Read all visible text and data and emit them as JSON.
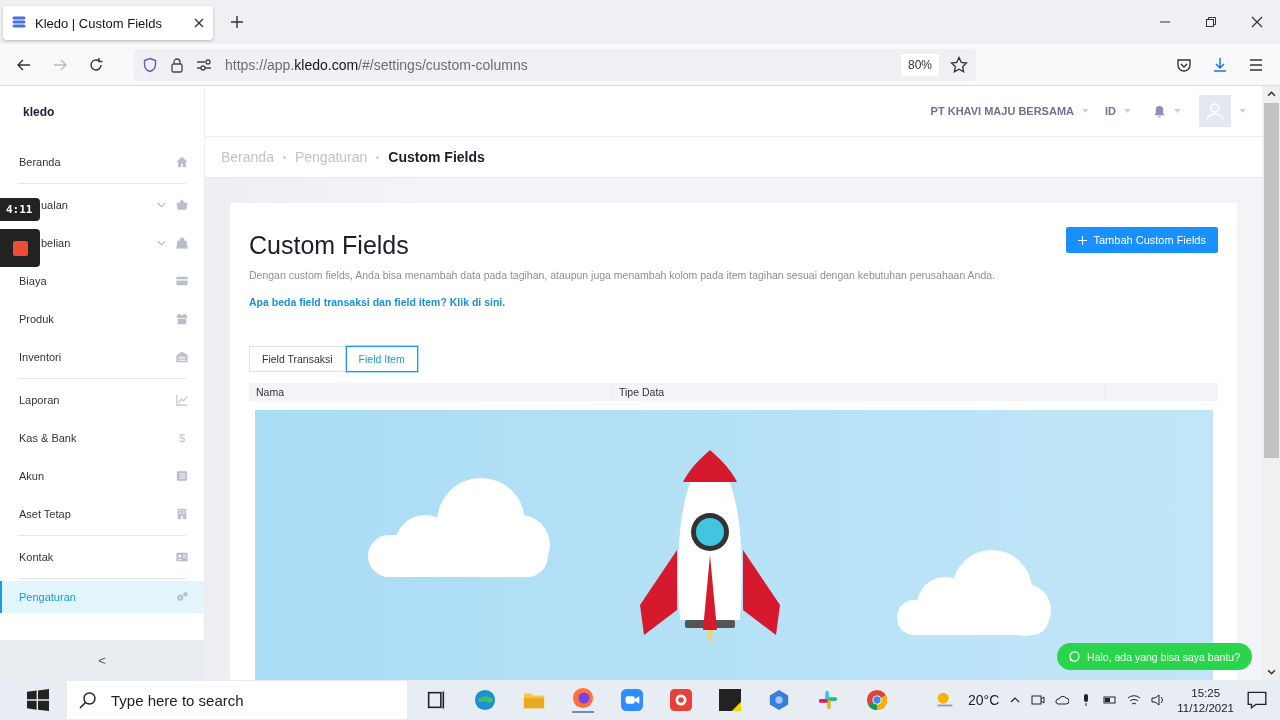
{
  "browser": {
    "tab_title": "Kledo | Custom Fields",
    "url_scheme": "https://app.",
    "url_domain": "kledo.com",
    "url_path": "/#/settings/custom-columns",
    "zoom": "80%"
  },
  "header": {
    "company": "PT KHAVI MAJU BERSAMA",
    "language": "ID"
  },
  "sidebar": {
    "logo": "kledo",
    "items": [
      {
        "label": "Beranda",
        "selected": false,
        "has_submenu": false,
        "divider_after": true
      },
      {
        "label": "ualan",
        "selected": false,
        "has_submenu": true,
        "divider_after": false
      },
      {
        "label": "belian",
        "selected": false,
        "has_submenu": true,
        "divider_after": false
      },
      {
        "label": "Biaya",
        "selected": false,
        "has_submenu": false,
        "divider_after": false
      },
      {
        "label": "Produk",
        "selected": false,
        "has_submenu": false,
        "divider_after": false
      },
      {
        "label": "Inventori",
        "selected": false,
        "has_submenu": false,
        "divider_after": true
      },
      {
        "label": "Laporan",
        "selected": false,
        "has_submenu": false,
        "divider_after": false
      },
      {
        "label": "Kas & Bank",
        "selected": false,
        "has_submenu": false,
        "divider_after": false,
        "glyph": "$"
      },
      {
        "label": "Akun",
        "selected": false,
        "has_submenu": false,
        "divider_after": false
      },
      {
        "label": "Aset Tetap",
        "selected": false,
        "has_submenu": false,
        "divider_after": true
      },
      {
        "label": "Kontak",
        "selected": false,
        "has_submenu": false,
        "divider_after": true
      },
      {
        "label": "Pengaturan",
        "selected": true,
        "has_submenu": false,
        "divider_after": false
      }
    ],
    "collapse": "<"
  },
  "recorder": {
    "timer": "4:11"
  },
  "breadcrumbs": [
    {
      "label": "Beranda",
      "current": false
    },
    {
      "label": "Pengaturan",
      "current": false
    },
    {
      "label": "Custom Fields",
      "current": true
    }
  ],
  "card": {
    "title": "Custom Fields",
    "description": "Dengan custom fields, Anda bisa menambah data pada tagihan, ataupun juga menambah kolom pada item tagihan sesuai dengan kebutuhan perusahaan Anda.",
    "link": "Apa beda field transaksi dan field item? Klik di sini.",
    "add_button": "Tambah Custom Fields",
    "tabs": [
      {
        "label": "Field Transaksi",
        "selected": false
      },
      {
        "label": "Field Item",
        "selected": true
      }
    ],
    "table": {
      "columns": [
        "Nama",
        "Tipe Data"
      ]
    }
  },
  "chat_button": "Halo, ada yang bisa saya bantu?",
  "taskbar": {
    "search_placeholder": "Type here to search",
    "temperature": "20°C",
    "time": "15:25",
    "date": "11/12/2021"
  }
}
